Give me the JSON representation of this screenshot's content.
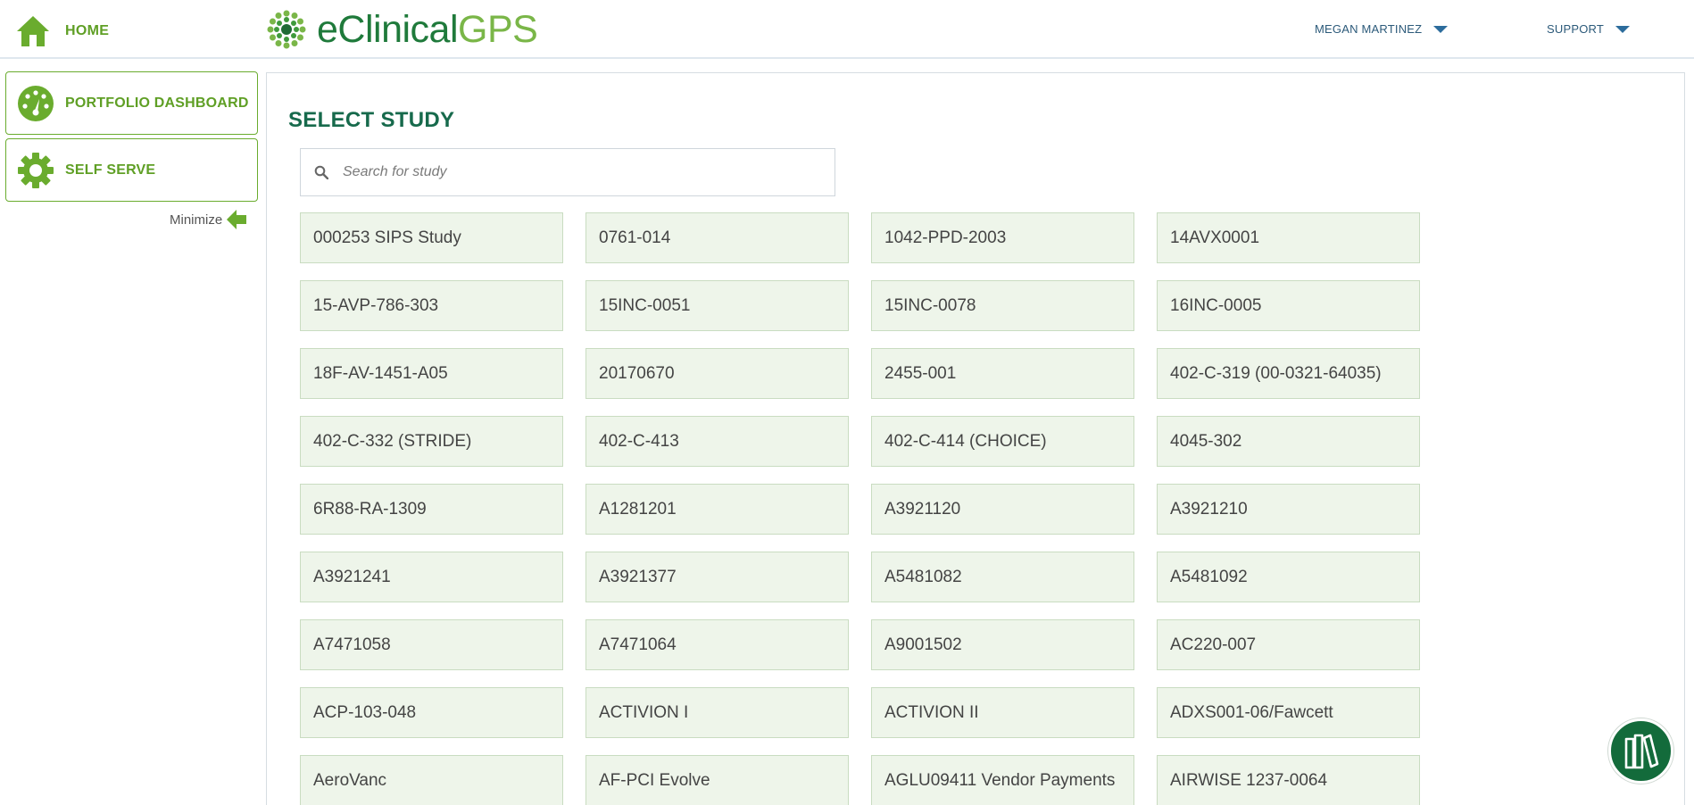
{
  "header": {
    "home_label": "HOME",
    "home_icon": "home-icon",
    "logo": {
      "prefix": "eClinical",
      "suffix": "GPS"
    },
    "user_menu_label": "MEGAN MARTINEZ",
    "support_menu_label": "SUPPORT"
  },
  "sidebar": {
    "items": [
      {
        "label": "PORTFOLIO DASHBOARD",
        "icon": "gauge-icon"
      },
      {
        "label": "SELF SERVE",
        "icon": "gear-icon"
      }
    ],
    "minimize_label": "Minimize"
  },
  "main": {
    "title": "SELECT STUDY",
    "search_placeholder": "Search for study",
    "search_value": "",
    "studies": [
      "000253 SIPS Study",
      "0761-014",
      "1042-PPD-2003",
      "14AVX0001",
      "15-AVP-786-303",
      "15INC-0051",
      "15INC-0078",
      "16INC-0005",
      "18F-AV-1451-A05",
      "20170670",
      "2455-001",
      "402-C-319 (00-0321-64035)",
      "402-C-332 (STRIDE)",
      "402-C-413",
      "402-C-414 (CHOICE)",
      "4045-302",
      "6R88-RA-1309",
      "A1281201",
      "A3921120",
      "A3921210",
      "A3921241",
      "A3921377",
      "A5481082",
      "A5481092",
      "A7471058",
      "A7471064",
      "A9001502",
      "AC220-007",
      "ACP-103-048",
      "ACTIVION I",
      "ACTIVION II",
      "ADXS001-06/Fawcett",
      "AeroVanc",
      "AF-PCI Evolve",
      "AGLU09411 Vendor Payments",
      "AIRWISE 1237-0064"
    ]
  },
  "help_fab_icon": "library-books-icon",
  "colors": {
    "brand_green": "#5f9f25",
    "dark_green": "#176a4c",
    "tile_bg": "#eef5ea",
    "tile_border": "#c9dcc1",
    "header_link": "#2c5a7a"
  }
}
